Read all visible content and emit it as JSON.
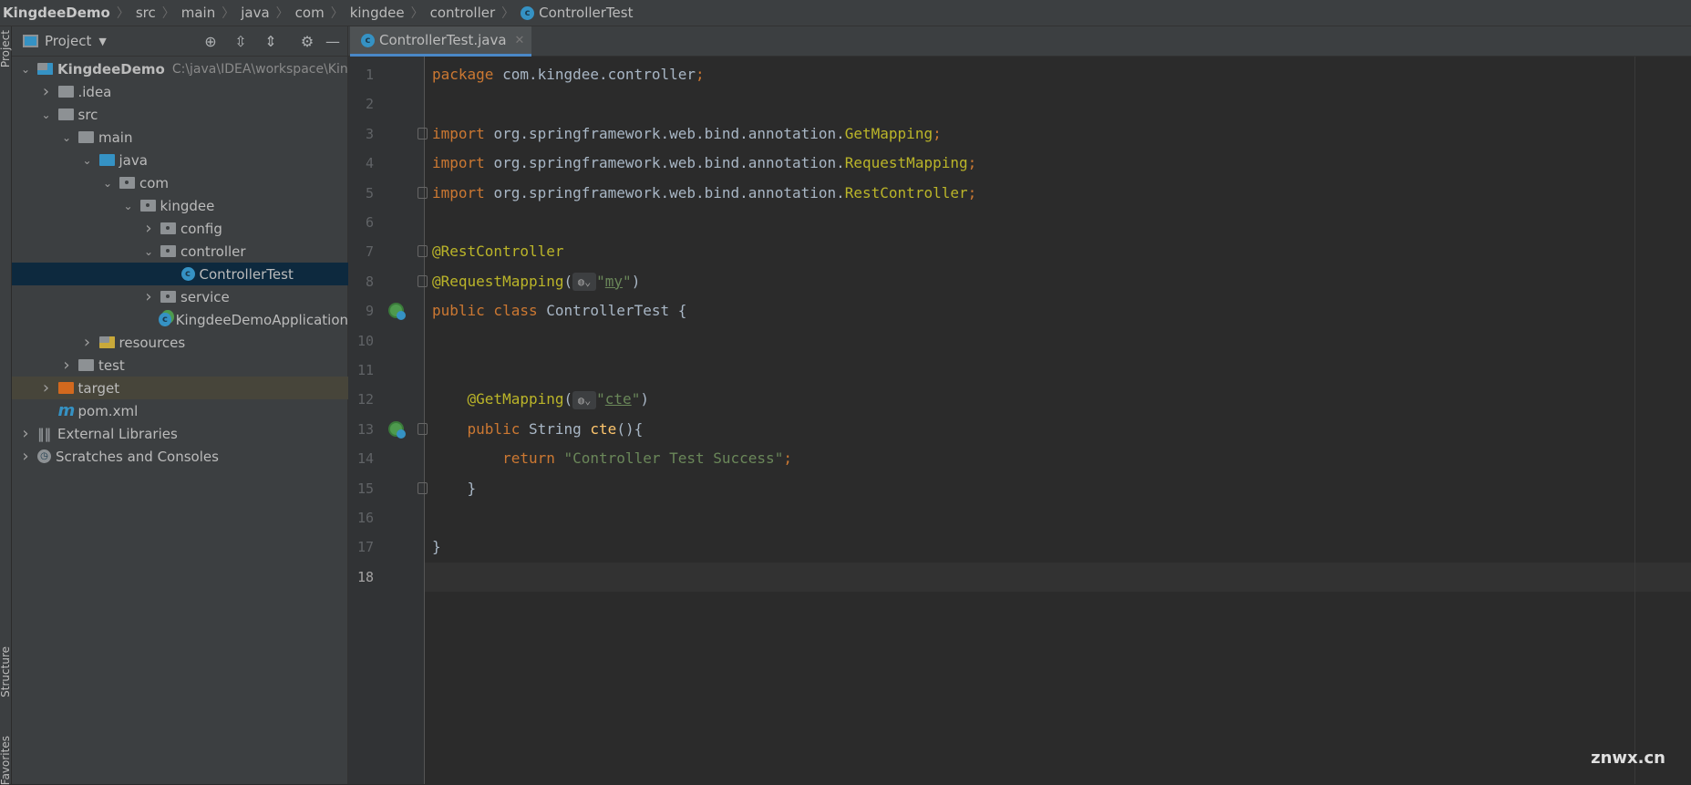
{
  "breadcrumb": [
    {
      "label": "KingdeeDemo"
    },
    {
      "label": "src"
    },
    {
      "label": "main"
    },
    {
      "label": "java"
    },
    {
      "label": "com"
    },
    {
      "label": "kingdee"
    },
    {
      "label": "controller"
    },
    {
      "label": "ControllerTest",
      "icon": "class-icon"
    }
  ],
  "side_strip": {
    "top": "Project",
    "middle": "Structure",
    "bottom": "Favorites"
  },
  "project_panel": {
    "title": "Project",
    "tools": [
      "locate-icon",
      "expand-all-icon",
      "collapse-all-icon",
      "gear-icon",
      "minimize-icon"
    ],
    "tree": [
      {
        "label": "KingdeeDemo",
        "hint": "C:\\java\\IDEA\\workspace\\Kin",
        "level": 0,
        "chevron": "down",
        "icon": "module",
        "bold": true
      },
      {
        "label": ".idea",
        "level": 1,
        "chevron": "right",
        "icon": "folder"
      },
      {
        "label": "src",
        "level": 1,
        "chevron": "down",
        "icon": "folder"
      },
      {
        "label": "main",
        "level": 2,
        "chevron": "down",
        "icon": "folder"
      },
      {
        "label": "java",
        "level": 3,
        "chevron": "down",
        "icon": "source-folder"
      },
      {
        "label": "com",
        "level": 4,
        "chevron": "down",
        "icon": "package"
      },
      {
        "label": "kingdee",
        "level": 5,
        "chevron": "down",
        "icon": "package"
      },
      {
        "label": "config",
        "level": 6,
        "chevron": "right",
        "icon": "package"
      },
      {
        "label": "controller",
        "level": 6,
        "chevron": "down",
        "icon": "package"
      },
      {
        "label": "ControllerTest",
        "level": 7,
        "icon": "class",
        "selected": true
      },
      {
        "label": "service",
        "level": 6,
        "chevron": "right",
        "icon": "package"
      },
      {
        "label": "KingdeeDemoApplication",
        "level": 6,
        "icon": "spring-boot-class"
      },
      {
        "label": "resources",
        "level": 3,
        "chevron": "right",
        "icon": "resources-folder"
      },
      {
        "label": "test",
        "level": 2,
        "chevron": "right",
        "icon": "folder"
      },
      {
        "label": "target",
        "level": 1,
        "chevron": "right",
        "icon": "excluded-folder",
        "highlight": true
      },
      {
        "label": "pom.xml",
        "level": 1,
        "icon": "maven"
      },
      {
        "label": "External Libraries",
        "level": 0,
        "chevron": "right",
        "icon": "libraries"
      },
      {
        "label": "Scratches and Consoles",
        "level": 0,
        "chevron": "right",
        "icon": "scratches"
      }
    ]
  },
  "editor": {
    "tab": {
      "label": "ControllerTest.java",
      "icon": "class-icon"
    },
    "current_line": 18,
    "lines": [
      [
        [
          "kw",
          "package "
        ],
        [
          "",
          "com.kingdee.controller"
        ],
        [
          "kw",
          ";"
        ]
      ],
      [],
      [
        [
          "kw",
          "import "
        ],
        [
          "",
          "org.springframework.web.bind.annotation."
        ],
        [
          "an",
          "GetMapping"
        ],
        [
          "kw",
          ";"
        ]
      ],
      [
        [
          "kw",
          "import "
        ],
        [
          "",
          "org.springframework.web.bind.annotation."
        ],
        [
          "an",
          "RequestMapping"
        ],
        [
          "kw",
          ";"
        ]
      ],
      [
        [
          "kw",
          "import "
        ],
        [
          "",
          "org.springframework.web.bind.annotation."
        ],
        [
          "an",
          "RestController"
        ],
        [
          "kw",
          ";"
        ]
      ],
      [],
      [
        [
          "an",
          "@RestController"
        ]
      ],
      [
        [
          "an",
          "@RequestMapping"
        ],
        [
          "",
          "("
        ],
        [
          "globe",
          ""
        ],
        [
          "st",
          "\""
        ],
        [
          "ul",
          "my"
        ],
        [
          "st",
          "\""
        ],
        [
          "",
          ")"
        ]
      ],
      [
        [
          "kw",
          "public class "
        ],
        [
          "",
          "ControllerTest {"
        ]
      ],
      [],
      [],
      [
        [
          "",
          "    "
        ],
        [
          "an",
          "@GetMapping"
        ],
        [
          "",
          "("
        ],
        [
          "globe",
          ""
        ],
        [
          "st",
          "\""
        ],
        [
          "ul",
          "cte"
        ],
        [
          "st",
          "\""
        ],
        [
          "",
          ")"
        ]
      ],
      [
        [
          "",
          "    "
        ],
        [
          "kw",
          "public "
        ],
        [
          "",
          "String "
        ],
        [
          "mt",
          "cte"
        ],
        [
          "",
          "(){"
        ]
      ],
      [
        [
          "",
          "        "
        ],
        [
          "kw",
          "return "
        ],
        [
          "st",
          "\"Controller Test Success\""
        ],
        [
          "kw",
          ";"
        ]
      ],
      [
        [
          "",
          "    }"
        ]
      ],
      [],
      [
        [
          "",
          "}"
        ]
      ],
      []
    ],
    "gutter_icons": [
      9,
      13
    ],
    "fold_markers": [
      3,
      5,
      7,
      8,
      13,
      15
    ]
  },
  "watermark": "znwx.cn"
}
